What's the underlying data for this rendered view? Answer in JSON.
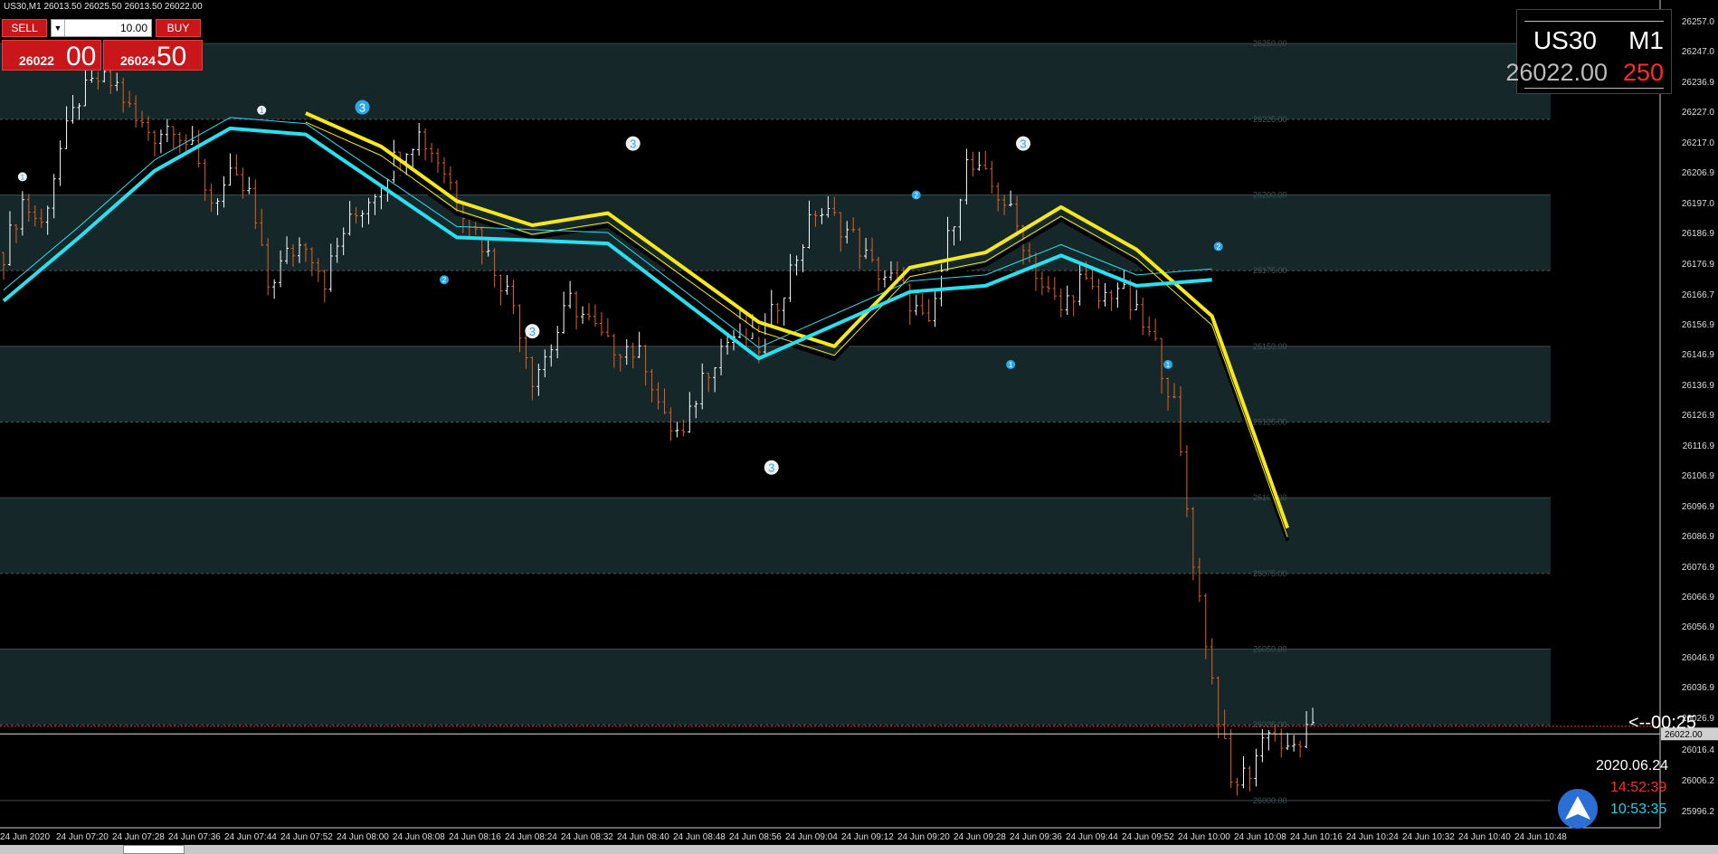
{
  "header": {
    "symbol_info": "US30,M1  26013.50 26025.50 26013.50 26022.00"
  },
  "trade_panel": {
    "sell_label": "SELL",
    "buy_label": "BUY",
    "lot_value": "10.00",
    "sell_price_small": "26022",
    "sell_price_big": "00",
    "buy_price_small": "26024",
    "buy_price_big": "50"
  },
  "info_box": {
    "symbol": "US30",
    "timeframe": "M1",
    "bid": "26022.00",
    "spread": "250"
  },
  "countdown": "<--00:25",
  "clock": {
    "date": "2020.06.24",
    "time_red": "14:52:39",
    "time_cyan": "10:53:35"
  },
  "colors": {
    "background": "#000000",
    "band": "#16272a",
    "bull": "#ffffff",
    "bear": "#e06020",
    "ma_up": "#27e0f0",
    "ma_down": "#f5e91c",
    "ma_black": "#000000",
    "price_line": "#ff2a2a"
  },
  "chart_data": {
    "type": "candlestick",
    "symbol": "US30",
    "timeframe": "M1",
    "ylim": [
      25991,
      26262
    ],
    "y_ticks": [
      26257.0,
      26247.0,
      26236.9,
      26227.0,
      26217.0,
      26206.9,
      26197.0,
      26186.9,
      26176.9,
      26166.7,
      26156.9,
      26146.9,
      26136.9,
      26126.9,
      26116.9,
      26106.9,
      26096.9,
      26086.9,
      26076.9,
      26066.9,
      26056.9,
      26046.9,
      26036.9,
      26026.9,
      26016.4,
      26006.2,
      25996.2
    ],
    "round_levels": [
      26250.0,
      26225.0,
      26200.0,
      26175.0,
      26150.0,
      26125.0,
      26100.0,
      26075.0,
      26050.0,
      26025.0,
      26000.0
    ],
    "x_ticks": [
      "24 Jun 2020",
      "24 Jun 07:20",
      "24 Jun 07:28",
      "24 Jun 07:36",
      "24 Jun 07:44",
      "24 Jun 07:52",
      "24 Jun 08:00",
      "24 Jun 08:08",
      "24 Jun 08:16",
      "24 Jun 08:24",
      "24 Jun 08:32",
      "24 Jun 08:40",
      "24 Jun 08:48",
      "24 Jun 08:56",
      "24 Jun 09:04",
      "24 Jun 09:12",
      "24 Jun 09:20",
      "24 Jun 09:28",
      "24 Jun 09:36",
      "24 Jun 09:44",
      "24 Jun 09:52",
      "24 Jun 10:00",
      "24 Jun 10:08",
      "24 Jun 10:16",
      "24 Jun 10:24",
      "24 Jun 10:32",
      "24 Jun 10:40",
      "24 Jun 10:48"
    ],
    "close_path": [
      [
        0,
        26181
      ],
      [
        3,
        26198
      ],
      [
        6,
        26190
      ],
      [
        9,
        26215
      ],
      [
        12,
        26232
      ],
      [
        15,
        26238
      ],
      [
        18,
        26236
      ],
      [
        21,
        26224
      ],
      [
        24,
        26220
      ],
      [
        27,
        26224
      ],
      [
        30,
        26214
      ],
      [
        33,
        26198
      ],
      [
        36,
        26205
      ],
      [
        39,
        26200
      ],
      [
        42,
        26170
      ],
      [
        45,
        26180
      ],
      [
        48,
        26185
      ],
      [
        51,
        26172
      ],
      [
        54,
        26188
      ],
      [
        57,
        26196
      ],
      [
        60,
        26205
      ],
      [
        63,
        26215
      ],
      [
        66,
        26220
      ],
      [
        69,
        26212
      ],
      [
        72,
        26200
      ],
      [
        75,
        26188
      ],
      [
        78,
        26176
      ],
      [
        81,
        26164
      ],
      [
        84,
        26140
      ],
      [
        87,
        26150
      ],
      [
        90,
        26165
      ],
      [
        93,
        26158
      ],
      [
        96,
        26150
      ],
      [
        99,
        26150
      ],
      [
        102,
        26145
      ],
      [
        105,
        26125
      ],
      [
        108,
        26120
      ],
      [
        111,
        26140
      ],
      [
        114,
        26150
      ],
      [
        117,
        26155
      ],
      [
        120,
        26150
      ],
      [
        123,
        26165
      ],
      [
        126,
        26180
      ],
      [
        129,
        26195
      ],
      [
        132,
        26192
      ],
      [
        135,
        26186
      ],
      [
        138,
        26176
      ],
      [
        141,
        26172
      ],
      [
        144,
        26165
      ],
      [
        147,
        26155
      ],
      [
        150,
        26185
      ],
      [
        153,
        26210
      ],
      [
        156,
        26205
      ],
      [
        159,
        26198
      ],
      [
        162,
        26185
      ],
      [
        165,
        26170
      ],
      [
        168,
        26162
      ],
      [
        171,
        26172
      ],
      [
        174,
        26165
      ],
      [
        177,
        26170
      ],
      [
        180,
        26160
      ],
      [
        183,
        26150
      ],
      [
        186,
        26130
      ],
      [
        189,
        26080
      ],
      [
        192,
        26040
      ],
      [
        195,
        26005
      ],
      [
        198,
        26010
      ],
      [
        201,
        26025
      ],
      [
        204,
        26015
      ],
      [
        207,
        26022
      ]
    ],
    "ma_yellow": [
      [
        48,
        26227
      ],
      [
        60,
        26216
      ],
      [
        72,
        26198
      ],
      [
        84,
        26190
      ],
      [
        96,
        26194
      ],
      [
        108,
        26176
      ],
      [
        120,
        26158
      ],
      [
        132,
        26150
      ],
      [
        144,
        26176
      ],
      [
        156,
        26181
      ],
      [
        168,
        26196
      ],
      [
        180,
        26182
      ],
      [
        192,
        26160
      ],
      [
        204,
        26090
      ]
    ],
    "ma_cyan": [
      [
        0,
        26165
      ],
      [
        12,
        26186
      ],
      [
        24,
        26208
      ],
      [
        36,
        26222
      ],
      [
        48,
        26220
      ],
      [
        72,
        26186
      ],
      [
        96,
        26184
      ],
      [
        120,
        26146
      ],
      [
        144,
        26168
      ],
      [
        156,
        26170
      ],
      [
        168,
        26180
      ],
      [
        180,
        26170
      ],
      [
        192,
        26172
      ]
    ],
    "swing_labels": [
      {
        "i": 3,
        "text": "1",
        "color": "white",
        "y": 26206
      },
      {
        "i": 41,
        "text": "1",
        "color": "white",
        "y": 26228
      },
      {
        "i": 57,
        "text": "3",
        "color": "blue",
        "y": 26229
      },
      {
        "i": 84,
        "text": "3",
        "color": "white",
        "y": 26155
      },
      {
        "i": 100,
        "text": "3",
        "color": "white",
        "y": 26217
      },
      {
        "i": 122,
        "text": "3",
        "color": "white",
        "y": 26110
      },
      {
        "i": 145,
        "text": "2",
        "color": "blue",
        "y": 26200
      },
      {
        "i": 162,
        "text": "3",
        "color": "white",
        "y": 26217
      },
      {
        "i": 193,
        "text": "2",
        "color": "blue",
        "y": 26183
      },
      {
        "i": 70,
        "text": "2",
        "color": "blue",
        "y": 26172
      },
      {
        "i": 160,
        "text": "1",
        "color": "blue",
        "y": 26144
      },
      {
        "i": 185,
        "text": "1",
        "color": "blue",
        "y": 26144
      }
    ]
  }
}
